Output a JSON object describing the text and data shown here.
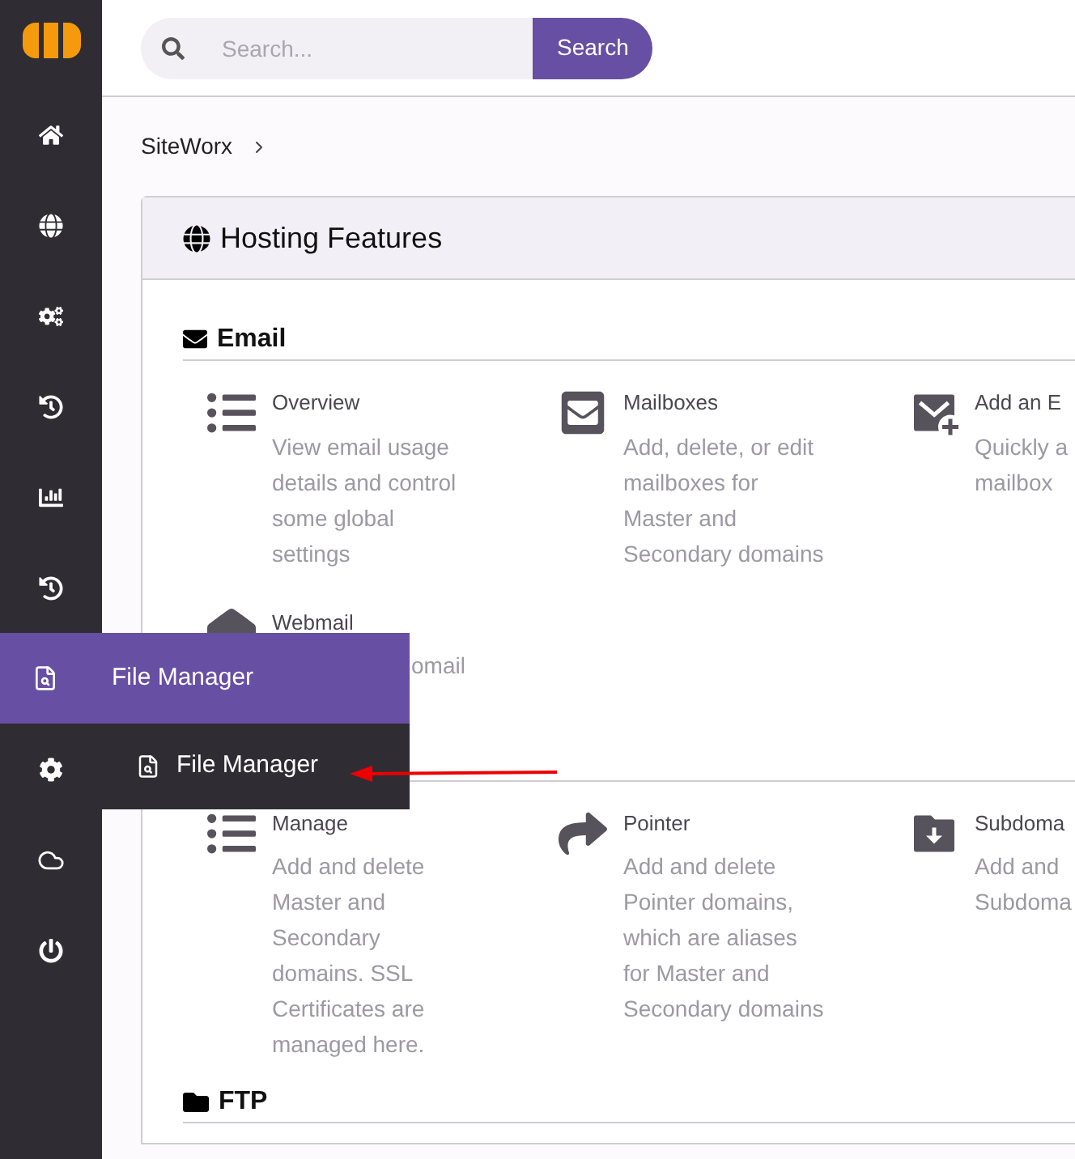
{
  "search": {
    "placeholder": "Search...",
    "button": "Search"
  },
  "sidebar": {
    "items": [
      {
        "kind": "home",
        "selected": false
      },
      {
        "kind": "globe",
        "selected": false
      },
      {
        "kind": "cogs",
        "selected": false
      },
      {
        "kind": "history",
        "selected": false
      },
      {
        "kind": "chart",
        "selected": false
      },
      {
        "kind": "history",
        "selected": false
      },
      {
        "kind": "file-search",
        "selected": true
      },
      {
        "kind": "gear",
        "selected": false
      },
      {
        "kind": "cloud",
        "selected": false
      },
      {
        "kind": "power",
        "selected": false
      }
    ]
  },
  "flyout": {
    "title": "File Manager",
    "items": [
      "File Manager"
    ]
  },
  "breadcrumb": [
    "SiteWorx"
  ],
  "card": {
    "title": "Hosting Features",
    "sections": [
      {
        "kind": "mail",
        "title": "Email",
        "items": [
          {
            "kind": "list",
            "title": "Overview",
            "description": "View email usage details and control some global settings"
          },
          {
            "kind": "mailbox",
            "title": "Mailboxes",
            "description": "Add, delete, or edit mailboxes for Master and Secondary domains"
          },
          {
            "kind": "add-mail",
            "title": "Add an E",
            "description": "Quickly a mailbox"
          },
          {
            "kind": "webmail",
            "title": "Webmail",
            "description": "omail",
            "covered": true
          }
        ]
      },
      {
        "kind": "hidden",
        "items": [
          {
            "kind": "list",
            "title": "Manage",
            "description": "Add and delete Master and Secondary domains. SSL Certificates are managed here."
          },
          {
            "kind": "pointer",
            "title": "Pointer",
            "description": "Add and delete Pointer domains, which are aliases for Master and Secondary domains"
          },
          {
            "kind": "folder",
            "title": "Subdoma",
            "description": "Add and Subdoma"
          }
        ]
      },
      {
        "kind": "folder",
        "title": "FTP"
      }
    ]
  }
}
